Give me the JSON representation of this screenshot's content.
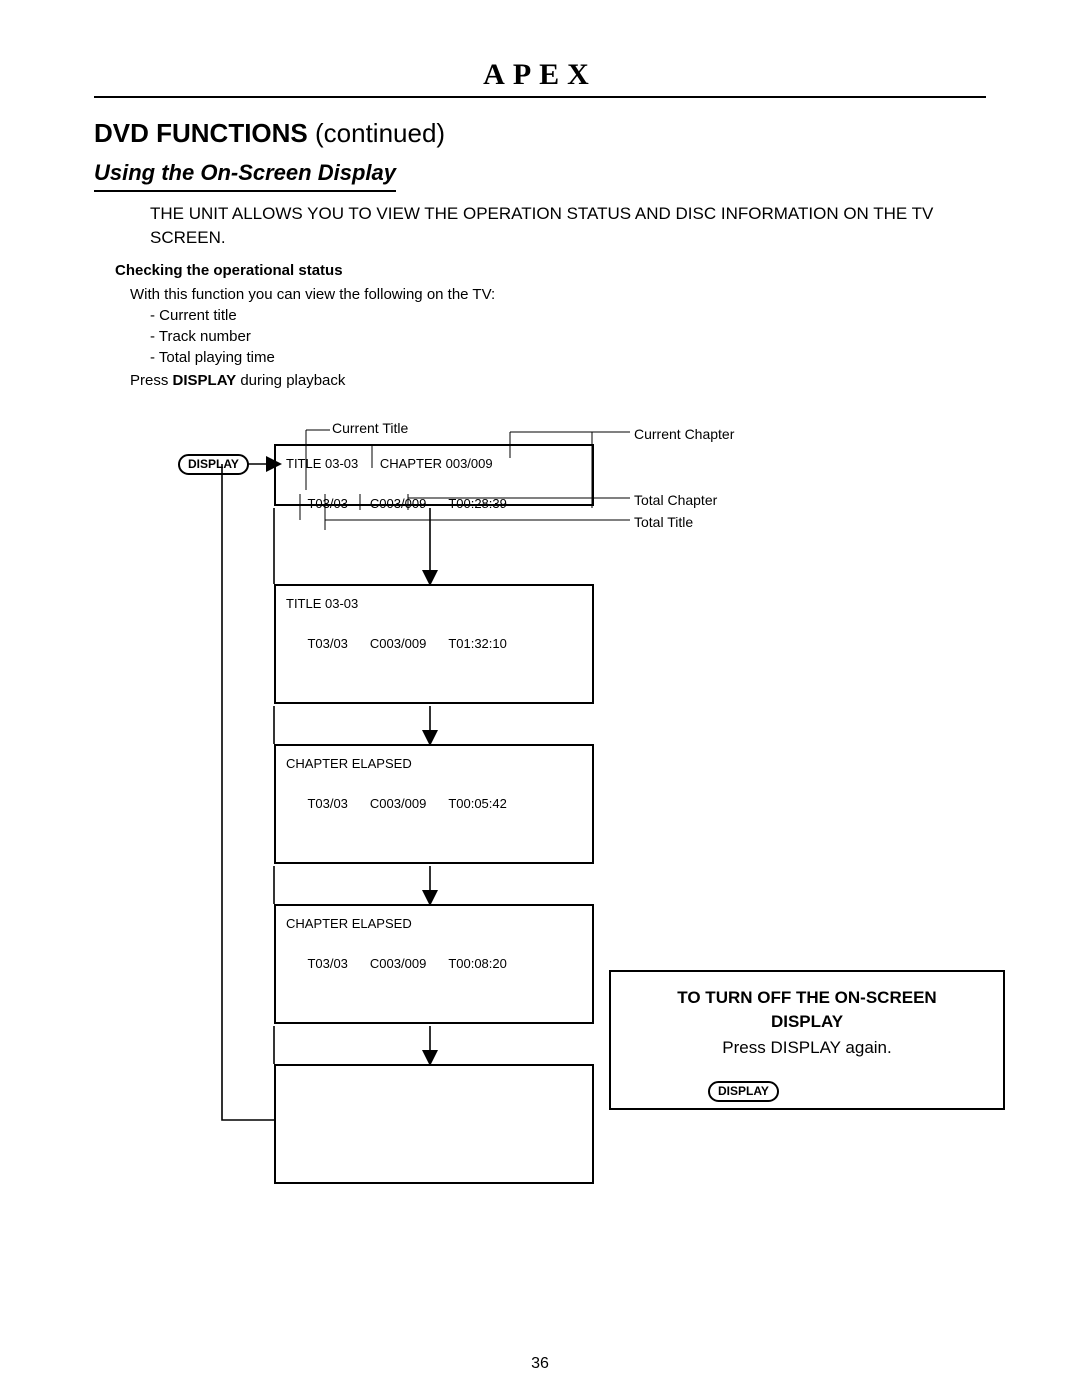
{
  "brand": "APEX",
  "section_bold": "DVD FUNCTIONS",
  "section_rest": "  (continued)",
  "subtitle": "Using the On-Screen Display",
  "intro": "THE UNIT ALLOWS YOU TO VIEW THE OPERATION STATUS AND DISC INFORMATION ON THE TV SCREEN.",
  "check_heading": "Checking the operational status",
  "check_desc_lead": "With this function you can view the following on the TV:",
  "check_items": [
    "- Current title",
    "- Track number",
    "- Total playing time"
  ],
  "press_prefix": "Press ",
  "press_bold": "DISPLAY",
  "press_suffix": " during playback",
  "display_btn": "DISPLAY",
  "annotations": {
    "current_title": "Current Title",
    "current_chapter": "Current Chapter",
    "total_chapter": "Total Chapter",
    "total_title": "Total Title"
  },
  "screens": {
    "s1": {
      "line1a": "TITLE 03-03",
      "line1b": "CHAPTER  003/009",
      "t": "T03/03",
      "c": "C003/009",
      "time": "T00:28:39"
    },
    "s2": {
      "line1": "TITLE 03-03",
      "t": "T03/03",
      "c": "C003/009",
      "time": "T01:32:10"
    },
    "s3": {
      "line1": "CHAPTER ELAPSED",
      "t": "T03/03",
      "c": "C003/009",
      "time": "T00:05:42"
    },
    "s4": {
      "line1": "CHAPTER ELAPSED",
      "t": "T03/03",
      "c": "C003/009",
      "time": "T00:08:20"
    }
  },
  "turnoff": {
    "heading1": "TO TURN OFF THE ON-SCREEN",
    "heading2": "DISPLAY",
    "text": "Press DISPLAY again."
  },
  "page_number": "36"
}
